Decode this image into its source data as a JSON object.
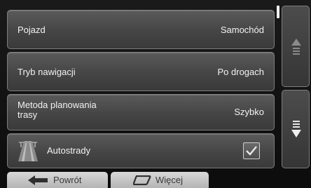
{
  "settings": {
    "rows": [
      {
        "label": "Pojazd",
        "value": "Samochód"
      },
      {
        "label": "Tryb nawigacji",
        "value": "Po drogach"
      },
      {
        "label_line1": "Metoda planowania",
        "label_line2": "trasy",
        "value": "Szybko"
      },
      {
        "label": "Autostrady",
        "icon": "highway-icon",
        "checked": true
      }
    ]
  },
  "scroll": {
    "up_icon": "scroll-up-arrow-icon",
    "down_icon": "scroll-down-arrow-icon"
  },
  "bottom_bar": {
    "back_label": "Powrót",
    "back_icon": "arrow-left-icon",
    "more_label": "Więcej",
    "more_icon": "more-icon"
  },
  "colors": {
    "row_bg": "#454545",
    "text": "#f2f2f2",
    "tab_bg": "#c8c8c8"
  }
}
